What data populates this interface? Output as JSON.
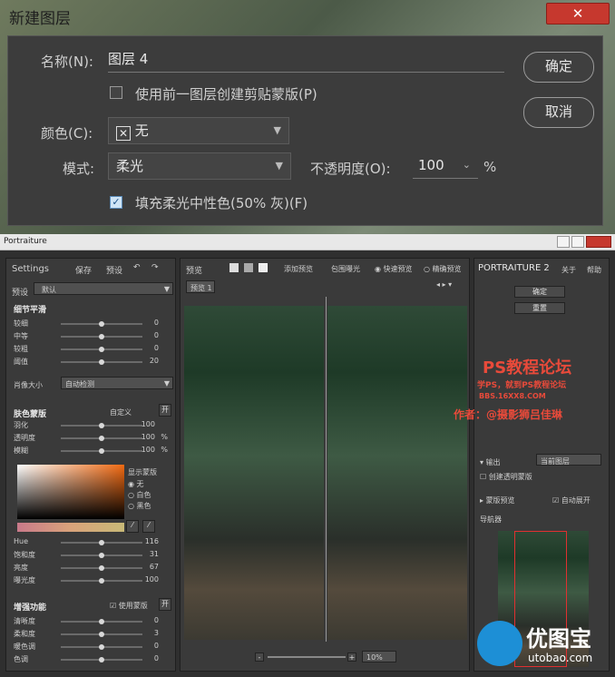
{
  "dialog": {
    "title": "新建图层",
    "close": "✕",
    "name_label": "名称(N):",
    "name_value": "图层 4",
    "clip_label": "使用前一图层创建剪贴蒙版(P)",
    "color_label": "颜色(C):",
    "color_value": "无",
    "mode_label": "模式:",
    "mode_value": "柔光",
    "opacity_label": "不透明度(O):",
    "opacity_value": "100",
    "opacity_unit": "%",
    "fill_label": "填充柔光中性色(50% 灰)(F)",
    "ok": "确定",
    "cancel": "取消",
    "color_icon": "x-box-icon"
  },
  "pt": {
    "title": "Portraiture",
    "left": {
      "settings": "Settings",
      "save": "保存",
      "preset_btn": "预设",
      "preset_label": "预设",
      "preset_value": "默认",
      "detail_title": "细节平滑",
      "detail": [
        {
          "l": "较细",
          "v": "0"
        },
        {
          "l": "中等",
          "v": "0"
        },
        {
          "l": "较粗",
          "v": "0"
        },
        {
          "l": "阈值",
          "v": "20"
        }
      ],
      "portrait_size": "肖像大小",
      "portrait_value": "自动检测",
      "mask_title": "肤色蒙版",
      "mask_mode": "自定义",
      "mask_toggle": "开",
      "mask": [
        {
          "l": "羽化",
          "v": "100"
        },
        {
          "l": "透明度",
          "v": "100",
          "u": "%"
        },
        {
          "l": "模糊",
          "v": "100",
          "u": "%"
        }
      ],
      "show_mask": "显示蒙版",
      "radio": [
        "无",
        "白色",
        "黑色"
      ],
      "hsl": [
        {
          "l": "Hue",
          "v": "116"
        },
        {
          "l": "饱和度",
          "v": "31"
        },
        {
          "l": "亮度",
          "v": "67"
        },
        {
          "l": "曝光度",
          "v": "100"
        }
      ],
      "enh_title": "增强功能",
      "use_mask": "使用蒙版",
      "enh_toggle": "开",
      "enh": [
        {
          "l": "清晰度",
          "v": "0"
        },
        {
          "l": "柔和度",
          "v": "3"
        },
        {
          "l": "暖色调",
          "v": "0"
        },
        {
          "l": "色调",
          "v": "0"
        }
      ]
    },
    "center": {
      "preview": "预览",
      "add_preview": "添加预览",
      "contain_exp": "包围曝光",
      "fast": "快速预览",
      "accurate": "精确预览",
      "tab": "预览 1",
      "zoom": "10%",
      "minus": "-",
      "plus": "+"
    },
    "right": {
      "logo": "PORTRAITURE 2",
      "about": "关于",
      "help": "帮助",
      "ok": "确定",
      "reset": "重置",
      "output_label": "输出",
      "output_value": "当前图层",
      "create_mask": "创建透明蒙版",
      "mask_preview": "蒙版预览",
      "auto_expand": "自动展开",
      "navigator": "导航器"
    },
    "watermark": {
      "line1": "PS教程论坛",
      "line2": "学PS，就到PS教程论坛",
      "line3": "BBS.16XX8.COM",
      "line4": "作者：@摄影狮吕佳琳",
      "brand_cn": "优图宝",
      "brand_en": "utobao.com"
    }
  }
}
